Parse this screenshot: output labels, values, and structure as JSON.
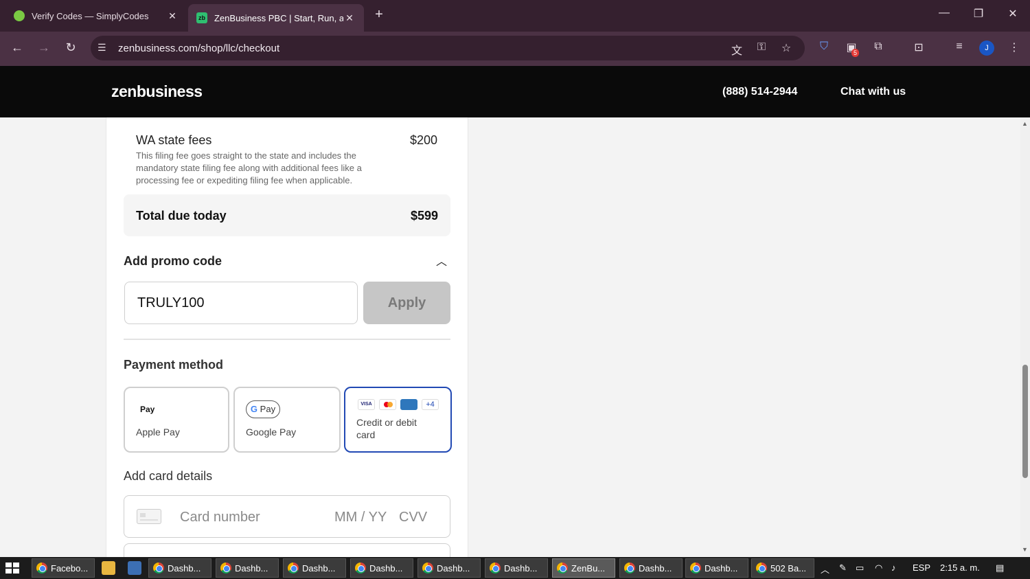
{
  "browser": {
    "tabs": [
      {
        "title": "Verify Codes — SimplyCodes",
        "favicon": "simplycodes-icon",
        "color": "#7ac943"
      },
      {
        "title": "ZenBusiness PBC | Start, Run, and Grow",
        "favicon": "zenbusiness-icon",
        "color": "#2fbf71"
      }
    ],
    "url": "zenbusiness.com/shop/llc/checkout",
    "extension_badge": "5",
    "profile_initial": "J"
  },
  "site": {
    "logo": "zenbusiness",
    "phone": "(888) 514-2944",
    "chat": "Chat with us"
  },
  "order": {
    "fee_title": "WA state fees",
    "fee_amount": "$200",
    "fee_description": "This filing fee goes straight to the state and includes the mandatory state filing fee along with additional fees like a processing fee or expediting filing fee when applicable.",
    "total_label": "Total due today",
    "total_amount": "$599"
  },
  "promo": {
    "heading": "Add promo code",
    "value": "TRULY100",
    "apply_label": "Apply"
  },
  "payment": {
    "heading": "Payment method",
    "options": [
      {
        "label": "Apple Pay",
        "logo": "Pay"
      },
      {
        "label": "Google Pay",
        "logo": "Pay"
      },
      {
        "label": "Credit or debit card",
        "selected": true
      }
    ],
    "card_brands": [
      "VISA",
      "Mastercard",
      "AMEX",
      "+4"
    ]
  },
  "card_details": {
    "heading": "Add card details",
    "number_placeholder": "Card number",
    "expiry_placeholder": "MM / YY",
    "cvv_placeholder": "CVV"
  },
  "taskbar": {
    "tasks": [
      "Facebo...",
      "Dashb...",
      "Dashb...",
      "Dashb...",
      "Dashb...",
      "Dashb...",
      "Dashb...",
      "ZenBu...",
      "Dashb...",
      "Dashb...",
      "502 Ba..."
    ],
    "language": "ESP",
    "time": "2:15 a. m."
  },
  "colors": {
    "accent": "#2149b4",
    "tab_bar": "#35202f",
    "toolbar": "#4b3144",
    "site_header": "#0a0a0a"
  }
}
